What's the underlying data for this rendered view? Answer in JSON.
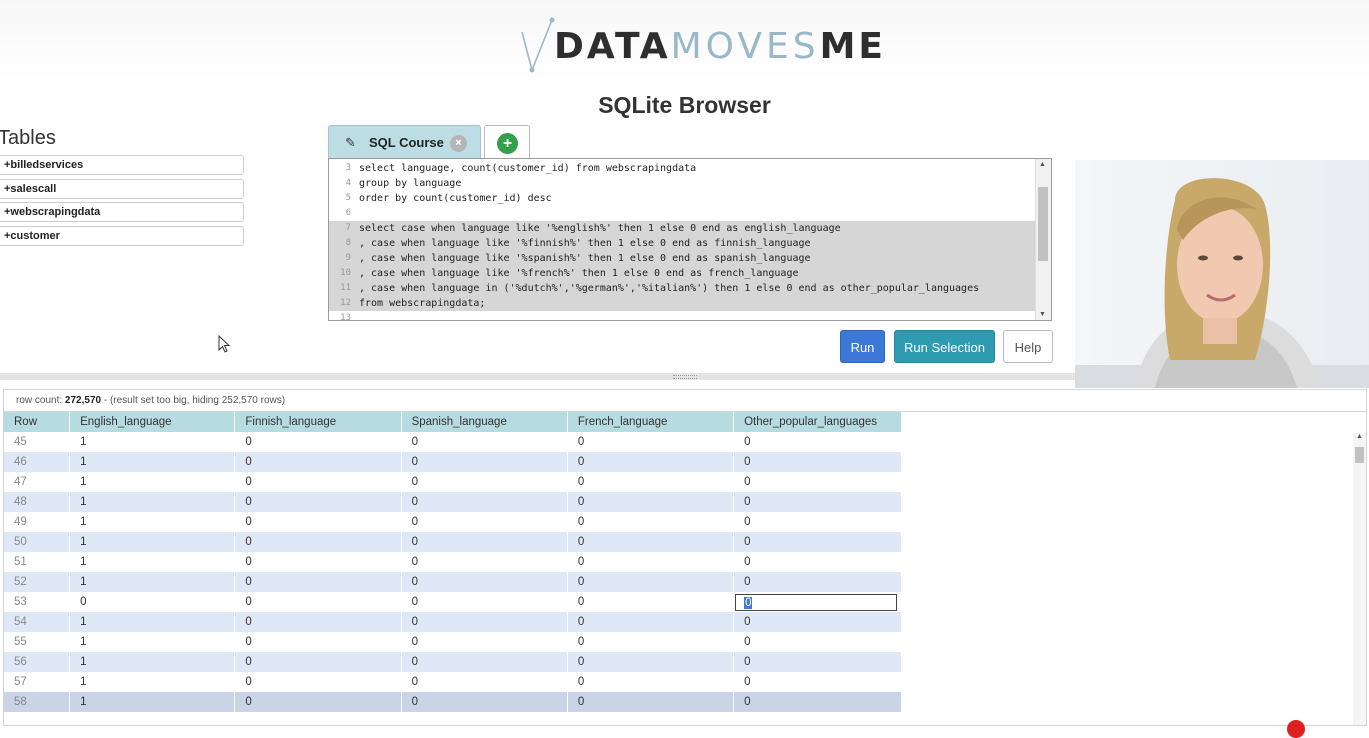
{
  "logo": {
    "part1": "DATA",
    "part2": "MOVES",
    "part3": "ME"
  },
  "app_title": "SQLite Browser",
  "sidebar": {
    "heading": "Tables",
    "tables": [
      "+billedservices",
      "+salescall",
      "+webscrapingdata",
      "+customer"
    ]
  },
  "tabs": {
    "active_label": "SQL Course",
    "close_symbol": "×",
    "add_symbol": "+"
  },
  "editor": {
    "lines": [
      {
        "n": "3",
        "code": "select language, count(customer_id) from webscrapingdata"
      },
      {
        "n": "4",
        "code": "group by language"
      },
      {
        "n": "5",
        "code": "order by count(customer_id) desc"
      },
      {
        "n": "6",
        "code": ""
      },
      {
        "n": "7",
        "code": "select case when language like '%english%' then 1 else 0 end as english_language"
      },
      {
        "n": "8",
        "code": ", case when language like '%finnish%' then 1 else 0 end as finnish_language"
      },
      {
        "n": "9",
        "code": ", case when language like '%spanish%' then 1 else 0 end as spanish_language"
      },
      {
        "n": "10",
        "code": ", case when language like '%french%' then 1 else 0 end as french_language"
      },
      {
        "n": "11",
        "code": ", case when language in ('%dutch%','%german%','%italian%') then 1 else 0 end as other_popular_languages"
      },
      {
        "n": "12",
        "code": "from webscrapingdata;"
      },
      {
        "n": "13",
        "code": ""
      }
    ]
  },
  "buttons": {
    "run": "Run",
    "run_selection": "Run Selection",
    "help": "Help"
  },
  "results": {
    "status_prefix": "row count: ",
    "row_count": "272,570",
    "status_suffix": " - (result set too big, hiding 252,570 rows)",
    "columns": [
      "Row",
      "English_language",
      "Finnish_language",
      "Spanish_language",
      "French_language",
      "Other_popular_languages"
    ],
    "rows": [
      [
        "45",
        "1",
        "0",
        "0",
        "0",
        "0"
      ],
      [
        "46",
        "1",
        "0",
        "0",
        "0",
        "0"
      ],
      [
        "47",
        "1",
        "0",
        "0",
        "0",
        "0"
      ],
      [
        "48",
        "1",
        "0",
        "0",
        "0",
        "0"
      ],
      [
        "49",
        "1",
        "0",
        "0",
        "0",
        "0"
      ],
      [
        "50",
        "1",
        "0",
        "0",
        "0",
        "0"
      ],
      [
        "51",
        "1",
        "0",
        "0",
        "0",
        "0"
      ],
      [
        "52",
        "1",
        "0",
        "0",
        "0",
        "0"
      ],
      [
        "53",
        "0",
        "0",
        "0",
        "0",
        "0"
      ],
      [
        "54",
        "1",
        "0",
        "0",
        "0",
        "0"
      ],
      [
        "55",
        "1",
        "0",
        "0",
        "0",
        "0"
      ],
      [
        "56",
        "1",
        "0",
        "0",
        "0",
        "0"
      ],
      [
        "57",
        "1",
        "0",
        "0",
        "0",
        "0"
      ],
      [
        "58",
        "1",
        "0",
        "0",
        "0",
        "0"
      ]
    ],
    "editing_row_index": 8
  },
  "colors": {
    "accent_run": "#3c78d8",
    "accent_run_selection": "#2f9bb0",
    "header_bg": "#b6dbe1",
    "tab_bg": "#bcdde4",
    "add_tab_green": "#35a04a"
  }
}
